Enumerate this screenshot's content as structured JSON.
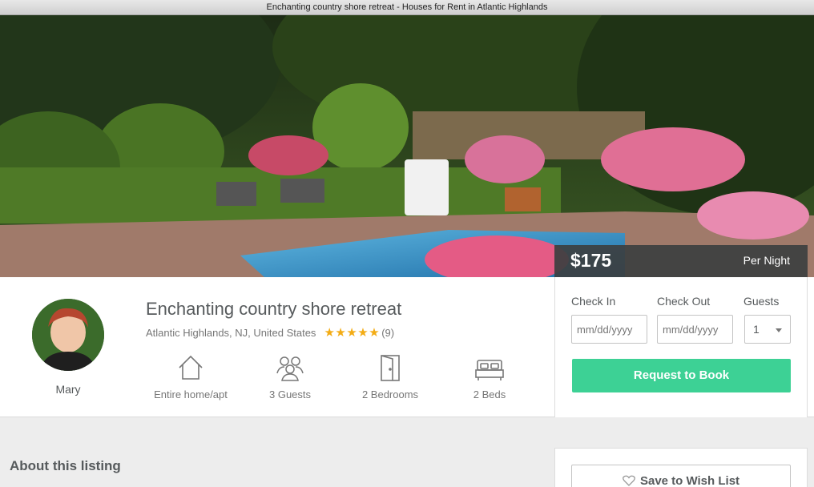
{
  "window": {
    "title": "Enchanting country shore retreat - Houses for Rent in Atlantic Highlands"
  },
  "pricing": {
    "price": "$175",
    "period": "Per Night"
  },
  "host": {
    "name": "Mary",
    "avatar_icon": "host-avatar"
  },
  "listing": {
    "title": "Enchanting country shore retreat",
    "location": "Atlantic Highlands, NJ, United States",
    "rating_stars": 5,
    "stars_text": "★★★★★",
    "review_count": "(9)",
    "facts": [
      {
        "icon": "home-icon",
        "label": "Entire home/apt"
      },
      {
        "icon": "guests-icon",
        "label": "3 Guests"
      },
      {
        "icon": "door-icon",
        "label": "2 Bedrooms"
      },
      {
        "icon": "bed-icon",
        "label": "2 Beds"
      }
    ]
  },
  "booking": {
    "check_in_label": "Check In",
    "check_out_label": "Check Out",
    "guests_label": "Guests",
    "date_placeholder": "mm/dd/yyyy",
    "guests_value": "1",
    "request_button": "Request to Book"
  },
  "about": {
    "heading": "About this listing"
  },
  "wishlist": {
    "button": "Save to Wish List",
    "icon": "heart-outline-icon"
  },
  "colors": {
    "accent_green": "#3dd195",
    "star_gold": "#f3ac15",
    "text": "#565a5c"
  }
}
